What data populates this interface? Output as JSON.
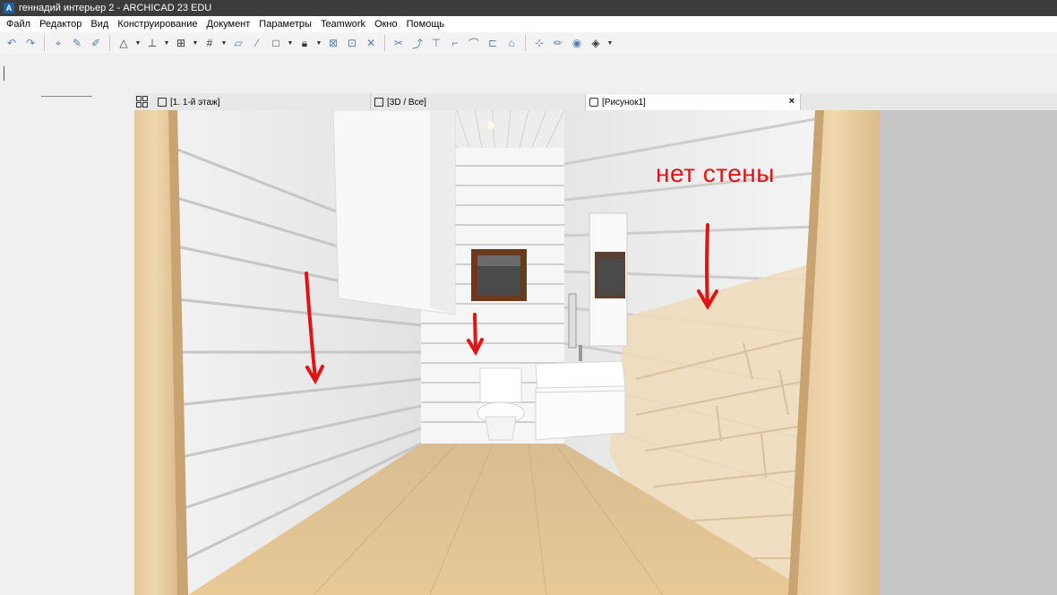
{
  "window": {
    "title": "геннадий интерьер 2 - ARCHICAD 23 EDU",
    "app_icon": "archicad-logo-icon"
  },
  "menu": {
    "items": [
      "Файл",
      "Редактор",
      "Вид",
      "Конструирование",
      "Документ",
      "Параметры",
      "Teamwork",
      "Окно",
      "Помощь"
    ]
  },
  "tabs": [
    {
      "label": "[1. 1-й этаж]",
      "icon": "floor-plan-icon"
    },
    {
      "label": "[3D / Все]",
      "icon": "3d-view-icon"
    },
    {
      "label": "[Рисунок1]",
      "icon": "camera-icon",
      "active": true
    }
  ],
  "viewport": {
    "annotation": "нет стены",
    "colors": {
      "annotation": "#e11414",
      "wall": "#f4f4f4",
      "floor": "#d9b88a",
      "wood_frame": "#e6c89a"
    }
  }
}
